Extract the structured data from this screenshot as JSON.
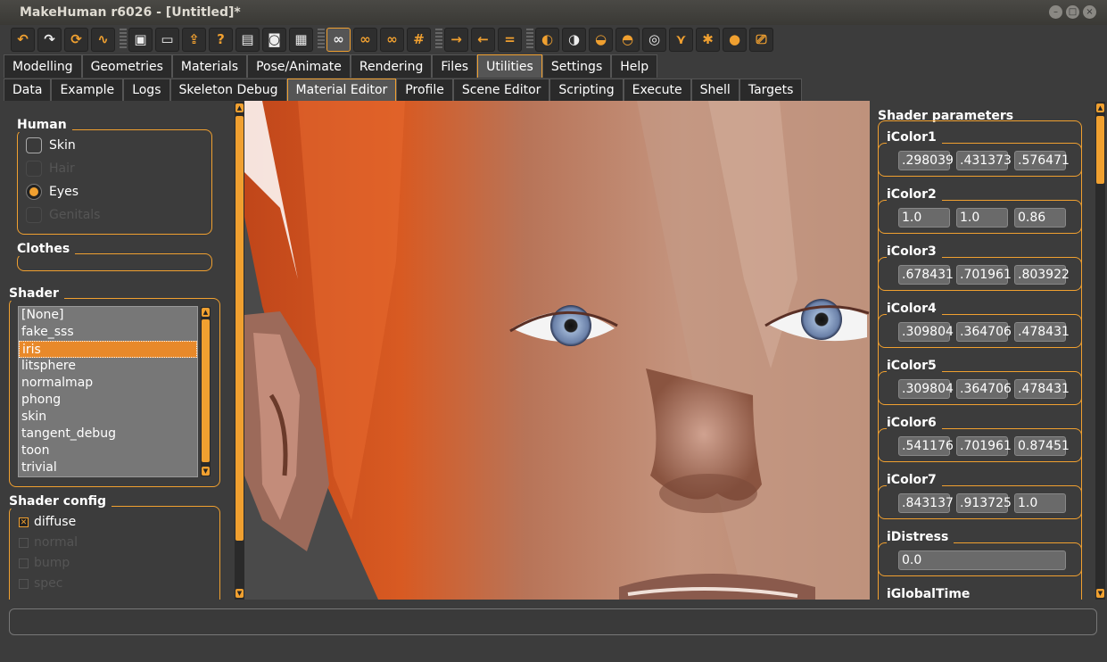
{
  "window": {
    "title": "MakeHuman r6026 - [Untitled]*"
  },
  "toolbar": {
    "icons": [
      "undo-icon",
      "redo-icon",
      "reset-icon",
      "smooth-icon",
      "save-icon",
      "load-icon",
      "export-icon",
      "help-icon",
      "save-tgt-icon",
      "screenshot-icon",
      "checker-icon",
      "glasses-icon",
      "glasses1-icon",
      "glasses2-icon",
      "wireframe-icon",
      "front-view-icon",
      "back-view-icon",
      "left-view-icon",
      "right-view-icon",
      "top-view-icon",
      "bottom-view-icon",
      "reset-camera-icon",
      "ear-icon",
      "arms-icon",
      "pose-icon",
      "head-icon",
      "camera-icon"
    ]
  },
  "tabs1": [
    "Modelling",
    "Geometries",
    "Materials",
    "Pose/Animate",
    "Rendering",
    "Files",
    "Utilities",
    "Settings",
    "Help"
  ],
  "tabs2": [
    "Data",
    "Example",
    "Logs",
    "Skeleton Debug",
    "Material Editor",
    "Profile",
    "Scene Editor",
    "Scripting",
    "Execute",
    "Shell",
    "Targets"
  ],
  "left": {
    "human_label": "Human",
    "human": [
      {
        "label": "Skin",
        "state": "off"
      },
      {
        "label": "Hair",
        "state": "disabled"
      },
      {
        "label": "Eyes",
        "state": "on"
      },
      {
        "label": "Genitals",
        "state": "disabled"
      }
    ],
    "clothes_label": "Clothes",
    "shader_label": "Shader",
    "shaders": [
      "[None]",
      "fake_sss",
      "iris",
      "litsphere",
      "normalmap",
      "phong",
      "skin",
      "tangent_debug",
      "toon",
      "trivial"
    ],
    "shader_config_label": "Shader config",
    "config": [
      {
        "label": "diffuse",
        "state": "on"
      },
      {
        "label": "normal",
        "state": "disabled"
      },
      {
        "label": "bump",
        "state": "disabled"
      },
      {
        "label": "spec",
        "state": "disabled"
      }
    ]
  },
  "right": {
    "title": "Shader parameters",
    "params": [
      {
        "name": "iColor1",
        "values": [
          ".298039",
          ".431373",
          ".576471"
        ]
      },
      {
        "name": "iColor2",
        "values": [
          "1.0",
          "1.0",
          "0.86"
        ]
      },
      {
        "name": "iColor3",
        "values": [
          ".678431",
          ".701961",
          ".803922"
        ]
      },
      {
        "name": "iColor4",
        "values": [
          ".309804",
          ".364706",
          ".478431"
        ]
      },
      {
        "name": "iColor5",
        "values": [
          ".309804",
          ".364706",
          ".478431"
        ]
      },
      {
        "name": "iColor6",
        "values": [
          ".541176",
          ".701961",
          "0.87451"
        ]
      },
      {
        "name": "iColor7",
        "values": [
          ".843137",
          ".913725",
          "1.0"
        ]
      },
      {
        "name": "iDistress",
        "values": [
          "0.0"
        ]
      },
      {
        "name": "iGlobalTime",
        "values": []
      }
    ]
  },
  "colors": {
    "accent": "#f0a030",
    "bg": "#3c3c3c",
    "skin": "#b07a5e",
    "skin_red": "#c04a1a"
  }
}
